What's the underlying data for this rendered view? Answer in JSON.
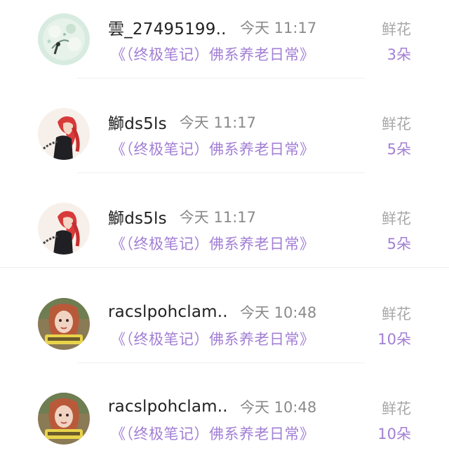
{
  "messages": [
    {
      "name": "雲_27495199...",
      "time": "今天 11:17",
      "book": "《（终极笔记）佛系养老日常》",
      "gift_label": "鲜花",
      "gift_count": "3朵",
      "avatar_icon": "flower-avatar-icon"
    },
    {
      "name": "鰤ds5ls",
      "time": "今天 11:17",
      "book": "《（终极笔记）佛系养老日常》",
      "gift_label": "鲜花",
      "gift_count": "5朵",
      "avatar_icon": "red-hair-character-avatar-icon"
    },
    {
      "name": "鰤ds5ls",
      "time": "今天 11:17",
      "book": "《（终极笔记）佛系养老日常》",
      "gift_label": "鲜花",
      "gift_count": "5朵",
      "avatar_icon": "red-hair-character-avatar-icon"
    },
    {
      "name": "racslpohclam...",
      "time": "今天 10:48",
      "book": "《（终极笔记）佛系养老日常》",
      "gift_label": "鲜花",
      "gift_count": "10朵",
      "avatar_icon": "portrait-avatar-icon"
    },
    {
      "name": "racslpohclam...",
      "time": "今天 10:48",
      "book": "《（终极笔记）佛系养老日常》",
      "gift_label": "鲜花",
      "gift_count": "10朵",
      "avatar_icon": "portrait-avatar-icon"
    }
  ],
  "colors": {
    "accent": "#a27fd4",
    "muted": "#8a8a8a",
    "divider": "#efefef"
  }
}
